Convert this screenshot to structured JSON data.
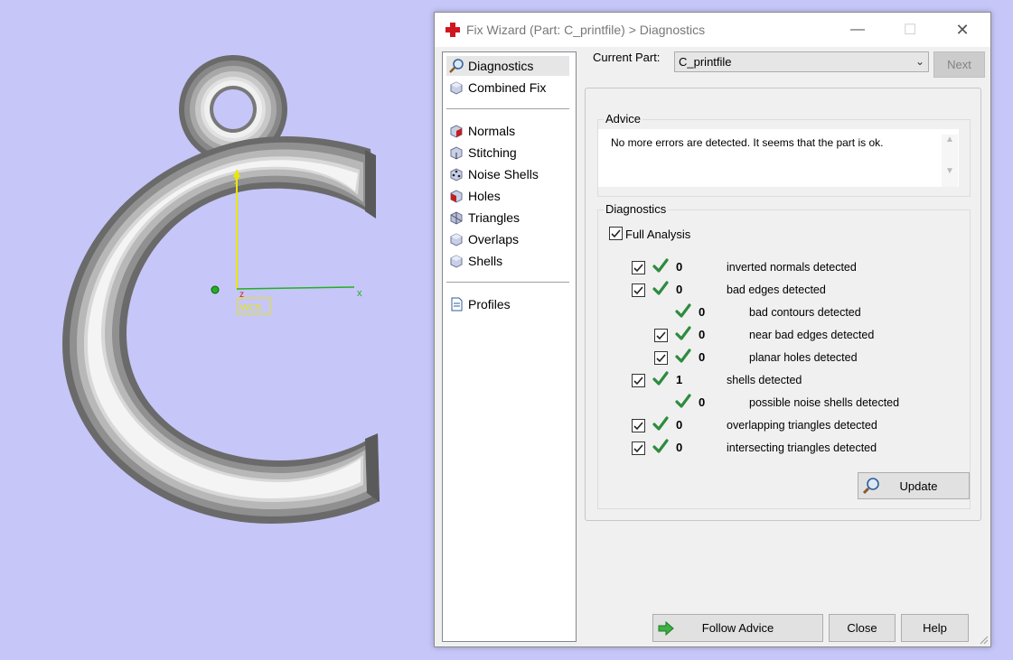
{
  "viewport": {
    "axis_x": "x",
    "axis_y": "y",
    "axis_z": "z",
    "wcs_label": "WCS",
    "colors": {
      "background": "#c6c6f8",
      "axis_x": "#22b022",
      "axis_y": "#e8e800"
    }
  },
  "dialog": {
    "title": "Fix Wizard (Part: C_printfile) > Diagnostics",
    "nav": {
      "items": [
        {
          "label": "Diagnostics",
          "icon": "magnifier-icon",
          "selected": true
        },
        {
          "label": "Combined Fix",
          "icon": "cube-icon"
        },
        {
          "label": "Normals",
          "icon": "cube-red-face-icon"
        },
        {
          "label": "Stitching",
          "icon": "cube-stitch-icon"
        },
        {
          "label": "Noise Shells",
          "icon": "cube-dots-icon"
        },
        {
          "label": "Holes",
          "icon": "cube-hole-icon"
        },
        {
          "label": "Triangles",
          "icon": "triangle-icon"
        },
        {
          "label": "Overlaps",
          "icon": "cube-overlap-icon"
        },
        {
          "label": "Shells",
          "icon": "cube-shell-icon"
        },
        {
          "label": "Profiles",
          "icon": "document-icon"
        }
      ]
    },
    "current_part_label": "Current Part:",
    "current_part_value": "C_printfile",
    "next_label": "Next",
    "advice": {
      "label": "Advice",
      "text": "No more errors are detected. It seems that the part is ok."
    },
    "diagnostics": {
      "label": "Diagnostics",
      "full_analysis_label": "Full Analysis",
      "full_analysis_checked": true,
      "rows": [
        {
          "count": "0",
          "text": "inverted normals detected",
          "checked": true,
          "indent": 0
        },
        {
          "count": "0",
          "text": "bad edges detected",
          "checked": true,
          "indent": 0
        },
        {
          "count": "0",
          "text": "bad contours detected",
          "checked": null,
          "indent": 1
        },
        {
          "count": "0",
          "text": "near bad edges detected",
          "checked": true,
          "indent": 1
        },
        {
          "count": "0",
          "text": "planar holes detected",
          "checked": true,
          "indent": 1
        },
        {
          "count": "1",
          "text": "shells detected",
          "checked": true,
          "indent": 0
        },
        {
          "count": "0",
          "text": "possible noise shells detected",
          "checked": null,
          "indent": 1
        },
        {
          "count": "0",
          "text": "overlapping triangles detected",
          "checked": true,
          "indent": 0
        },
        {
          "count": "0",
          "text": "intersecting triangles detected",
          "checked": true,
          "indent": 0
        }
      ],
      "update_label": "Update"
    },
    "buttons": {
      "follow_advice": "Follow Advice",
      "close": "Close",
      "help": "Help"
    },
    "colors": {
      "tick": "#2e8b3e",
      "follow_arrow": "#3cb043"
    }
  }
}
